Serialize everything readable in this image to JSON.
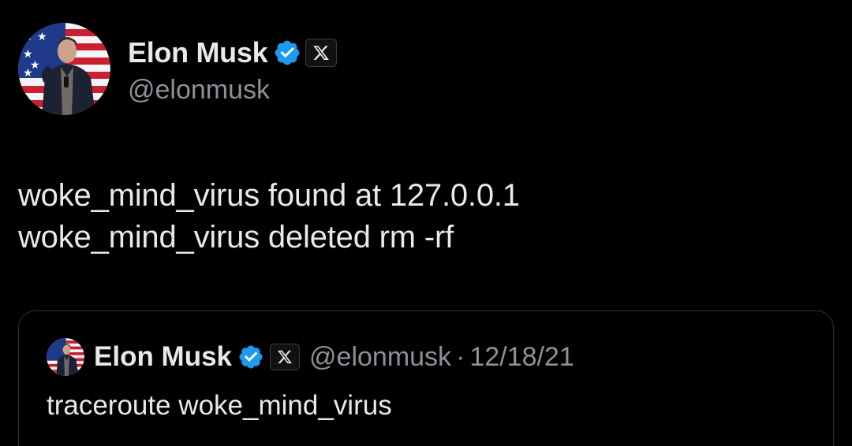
{
  "tweet": {
    "author": {
      "display_name": "Elon Musk",
      "handle": "@elonmusk",
      "verified": true,
      "affiliate_badge_icon": "x-logo-icon"
    },
    "lines": [
      "woke_mind_virus found at 127.0.0.1",
      "woke_mind_virus deleted rm -rf"
    ]
  },
  "quoted_tweet": {
    "author": {
      "display_name": "Elon Musk",
      "handle": "@elonmusk",
      "verified": true,
      "affiliate_badge_icon": "x-logo-icon"
    },
    "separator": "·",
    "date": "12/18/21",
    "text": "traceroute woke_mind_virus"
  },
  "colors": {
    "background": "#000000",
    "primary_text": "#e7e9ea",
    "secondary_text": "#8b9196",
    "verified_blue": "#1d9bf0",
    "border": "#2f3336"
  }
}
